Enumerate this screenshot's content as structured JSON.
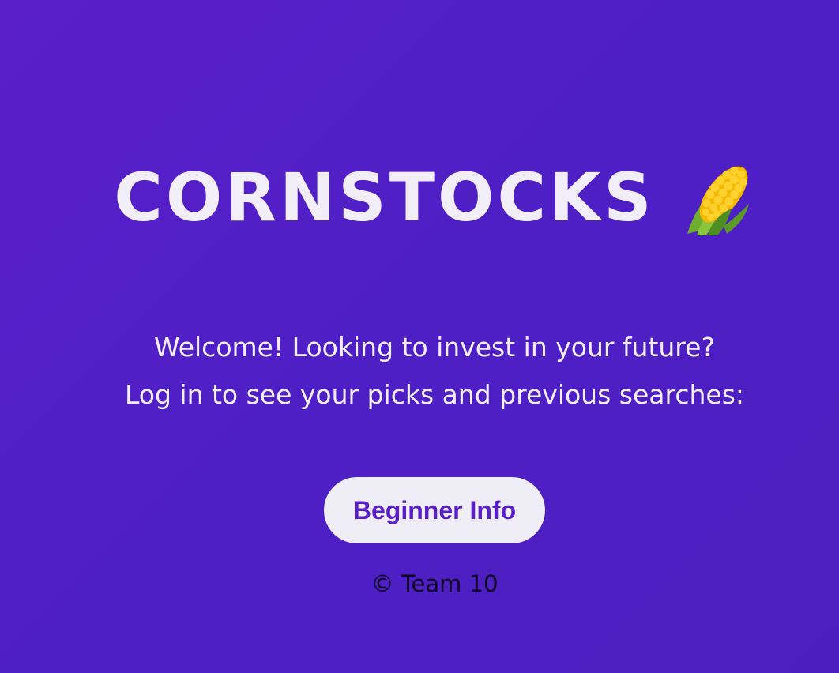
{
  "header": {
    "title": "CORNSTOCKS",
    "title_icon": "corn-icon"
  },
  "intro": {
    "line1": "Welcome! Looking to invest in your future?",
    "line2": "Log in to see your picks and previous searches:"
  },
  "actions": {
    "beginner_info_label": "Beginner Info"
  },
  "footer": {
    "copyright": "© Team 10"
  },
  "colors": {
    "background": "#5020c6",
    "button_bg": "#efedf5",
    "button_text": "#5a1fc9"
  }
}
